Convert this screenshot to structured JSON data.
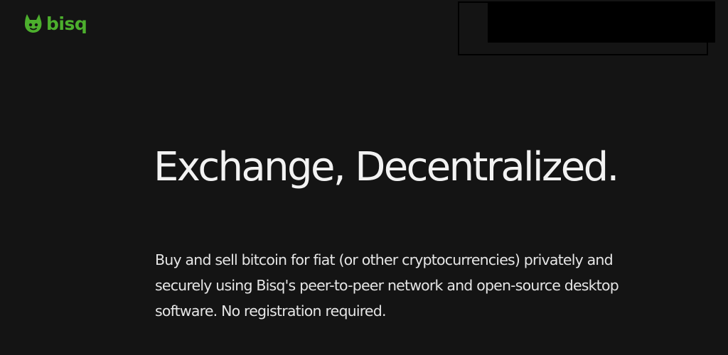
{
  "brand": {
    "name": "bisq",
    "color": "#4caf2d"
  },
  "colors": {
    "background": "#141414",
    "text": "#ececec",
    "overlay": "#000000"
  },
  "hero": {
    "title": "Exchange, Decentralized.",
    "subtitle": "Buy and sell bitcoin for fiat (or other cryptocurrencies) privately and securely using Bisq's peer-to-peer network and open-source desktop software. No registration required."
  }
}
